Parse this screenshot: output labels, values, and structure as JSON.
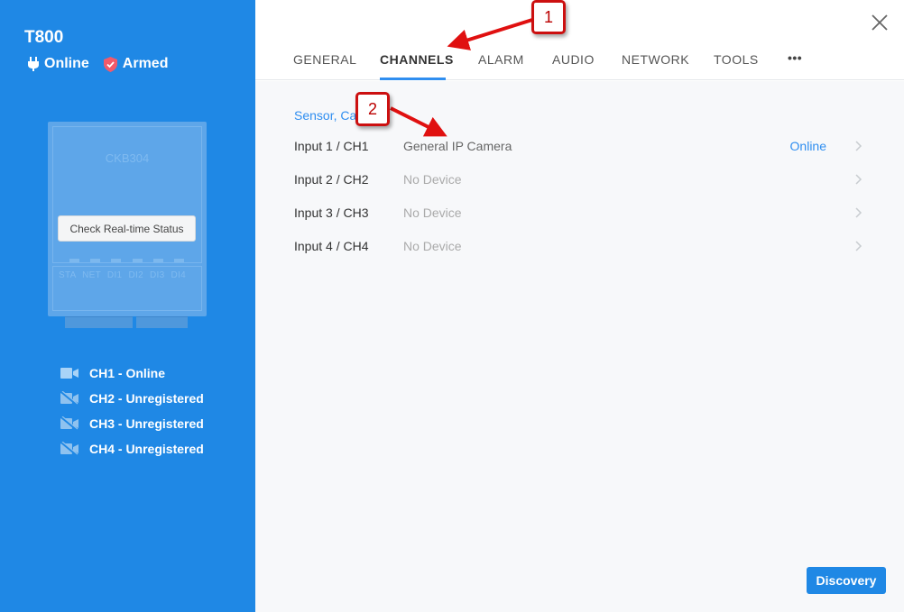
{
  "sidebar": {
    "device_name": "T800",
    "online_label": "Online",
    "armed_label": "Armed",
    "device_model": "CKB304",
    "check_status_label": "Check Real-time Status",
    "led_labels": "STA NET DI1 DI2 DI3 DI4",
    "channels": [
      {
        "label": "CH1 - Online",
        "icon": "camera-icon"
      },
      {
        "label": "CH2 - Unregistered",
        "icon": "camera-off-icon"
      },
      {
        "label": "CH3 - Unregistered",
        "icon": "camera-off-icon"
      },
      {
        "label": "CH4 - Unregistered",
        "icon": "camera-off-icon"
      }
    ]
  },
  "tabs": [
    {
      "label": "GENERAL"
    },
    {
      "label": "CHANNELS",
      "active": true
    },
    {
      "label": "ALARM"
    },
    {
      "label": "AUDIO"
    },
    {
      "label": "NETWORK"
    },
    {
      "label": "TOOLS"
    },
    {
      "label": "•••"
    }
  ],
  "channels_panel": {
    "section_title": "Sensor, Ca",
    "rows": [
      {
        "input": "Input 1 / CH1",
        "device": "General IP Camera",
        "status": "Online"
      },
      {
        "input": "Input 2 / CH2",
        "device": "No Device",
        "status": ""
      },
      {
        "input": "Input 3 / CH3",
        "device": "No Device",
        "status": ""
      },
      {
        "input": "Input 4 / CH4",
        "device": "No Device",
        "status": ""
      }
    ]
  },
  "discovery_label": "Discovery",
  "annotations": [
    {
      "number": "1"
    },
    {
      "number": "2"
    }
  ],
  "colors": {
    "sidebar_bg": "#1f88e5",
    "accent": "#2f8ef0",
    "annotation_red": "#cc1010"
  }
}
